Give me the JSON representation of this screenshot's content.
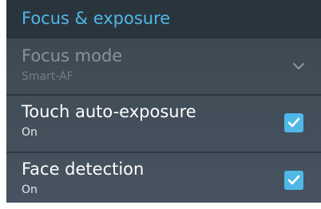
{
  "header": {
    "title": "Focus & exposure"
  },
  "settings": [
    {
      "title": "Focus mode",
      "summary": "Smart-AF",
      "enabled": false,
      "control": "dropdown",
      "icon": "chevron-down-icon"
    },
    {
      "title": "Touch auto-exposure",
      "summary": "On",
      "enabled": true,
      "control": "checkbox",
      "checked": true,
      "icon": "checkmark-icon"
    },
    {
      "title": "Face detection",
      "summary": "On",
      "enabled": true,
      "control": "checkbox",
      "checked": true,
      "icon": "checkmark-icon"
    }
  ],
  "colors": {
    "accent": "#4fb8e7",
    "header_background": "#2a343d",
    "panel_background": "#414d57",
    "disabled_text": "#8a939b"
  }
}
